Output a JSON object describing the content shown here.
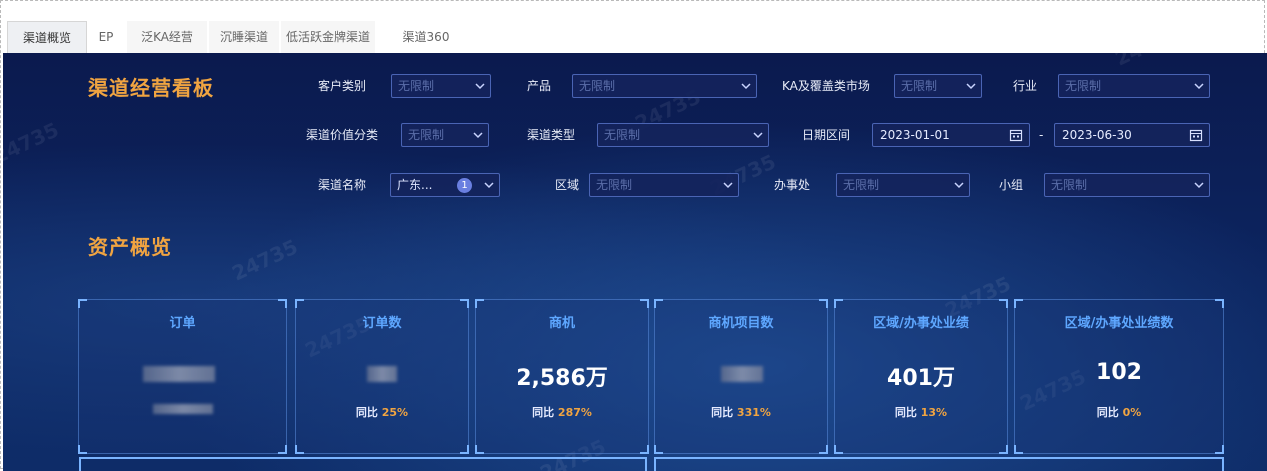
{
  "tabs": [
    {
      "label": "渠道概览",
      "active": true
    },
    {
      "label": "EP"
    },
    {
      "label": "泛KA经营"
    },
    {
      "label": "沉睡渠道"
    },
    {
      "label": "低活跃金牌渠道"
    },
    {
      "label": "渠道360"
    }
  ],
  "dashboard_title": "渠道经营看板",
  "section_title": "资产概览",
  "watermark": "24735",
  "filters": {
    "customer_type": {
      "label": "客户类别",
      "placeholder": "无限制"
    },
    "product": {
      "label": "产品",
      "placeholder": "无限制"
    },
    "ka_market": {
      "label": "KA及覆盖类市场",
      "placeholder": "无限制"
    },
    "industry": {
      "label": "行业",
      "placeholder": "无限制"
    },
    "channel_value": {
      "label": "渠道价值分类",
      "placeholder": "无限制"
    },
    "channel_type": {
      "label": "渠道类型",
      "placeholder": "无限制"
    },
    "date_range": {
      "label": "日期区间",
      "start": "2023-01-01",
      "separator": "-",
      "end": "2023-06-30"
    },
    "channel_name": {
      "label": "渠道名称",
      "value": "广东...",
      "badge": "1"
    },
    "region": {
      "label": "区域",
      "placeholder": "无限制"
    },
    "office": {
      "label": "办事处",
      "placeholder": "无限制"
    },
    "group": {
      "label": "小组",
      "placeholder": "无限制"
    }
  },
  "cards": [
    {
      "title": "订单",
      "value": "",
      "yoy_label": "",
      "yoy_pct": ""
    },
    {
      "title": "订单数",
      "value": "",
      "yoy_label": "同比",
      "yoy_pct": "25%"
    },
    {
      "title": "商机",
      "value": "2,586万",
      "yoy_label": "同比",
      "yoy_pct": "287%"
    },
    {
      "title": "商机项目数",
      "value": "",
      "yoy_label": "同比",
      "yoy_pct": "331%"
    },
    {
      "title": "区域/办事处业绩",
      "value": "401万",
      "yoy_label": "同比",
      "yoy_pct": "13%"
    },
    {
      "title": "区域/办事处业绩数",
      "value": "102",
      "yoy_label": "同比",
      "yoy_pct": "0%"
    }
  ],
  "colors": {
    "accent_orange": "#f0a441",
    "card_title_blue": "#5ea7ff",
    "bg_navy": "#0b1a4e"
  }
}
